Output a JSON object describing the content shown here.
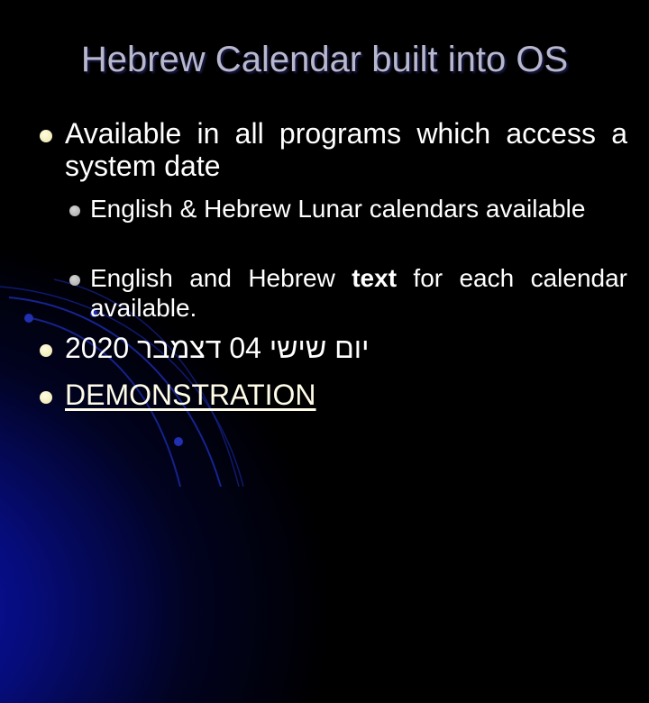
{
  "slide": {
    "title": "Hebrew Calendar built into OS",
    "bullets": [
      {
        "text": "Available in all programs which access a system date"
      },
      {
        "text": "English & Hebrew Lunar calendars available"
      },
      {
        "text_before": "English and Hebrew ",
        "text_bold": "text",
        "text_after": " for each calendar available."
      },
      {
        "text": "2020 יום שישי 04 דצמבר"
      },
      {
        "text": "DEMONSTRATION"
      }
    ]
  },
  "colors": {
    "background": "#000000",
    "title": "#b8b8cc",
    "text": "#ffffff",
    "level1_bullet": "#f2eeb8",
    "level2_bullet": "#b8b8b8",
    "accent_blue": "#1020c8",
    "link": "#fffde8"
  }
}
